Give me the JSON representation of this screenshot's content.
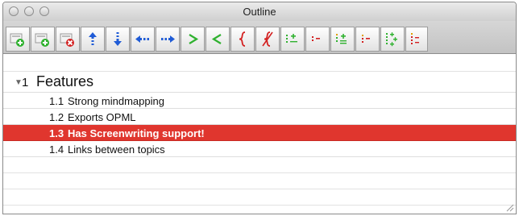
{
  "window": {
    "title": "Outline"
  },
  "toolbar": {
    "buttons": [
      {
        "name": "add-child-topic-button",
        "icon": "page-plus-green-icon"
      },
      {
        "name": "add-sibling-topic-button",
        "icon": "page-plus-green-icon"
      },
      {
        "name": "delete-topic-button",
        "icon": "page-x-red-icon"
      },
      {
        "name": "move-up-button",
        "icon": "arrow-up-blue-icon"
      },
      {
        "name": "move-down-button",
        "icon": "arrow-down-blue-icon"
      },
      {
        "name": "move-left-button",
        "icon": "arrow-left-blue-icon"
      },
      {
        "name": "move-right-button",
        "icon": "arrow-right-blue-icon"
      },
      {
        "name": "indent-button",
        "icon": "greater-than-green-icon"
      },
      {
        "name": "outdent-button",
        "icon": "less-than-green-icon"
      },
      {
        "name": "group-button",
        "icon": "brace-red-icon"
      },
      {
        "name": "ungroup-button",
        "icon": "brace-struck-red-icon"
      },
      {
        "name": "expand-one-button",
        "icon": "expand-plus-icon"
      },
      {
        "name": "collapse-one-button",
        "icon": "collapse-minus-icon"
      },
      {
        "name": "expand-level-button",
        "icon": "expand-plus-icon"
      },
      {
        "name": "collapse-level-button",
        "icon": "collapse-minus-icon"
      },
      {
        "name": "expand-all-button",
        "icon": "expand-all-icon"
      },
      {
        "name": "collapse-all-button",
        "icon": "collapse-all-icon"
      }
    ]
  },
  "outline": {
    "root": {
      "number": "1",
      "label": "Features",
      "expanded_icon": "disclosure-triangle-down-icon"
    },
    "children": [
      {
        "number": "1.1",
        "label": "Strong mindmapping",
        "selected": false
      },
      {
        "number": "1.2",
        "label": "Exports OPML",
        "selected": false
      },
      {
        "number": "1.3",
        "label": "Has Screenwriting support!",
        "selected": true
      },
      {
        "number": "1.4",
        "label": "Links between topics",
        "selected": false
      }
    ]
  },
  "colors": {
    "selection": "#e0362e",
    "toolbar_green": "#2fb12f",
    "toolbar_blue": "#1f5bd6",
    "toolbar_red": "#d32020"
  }
}
